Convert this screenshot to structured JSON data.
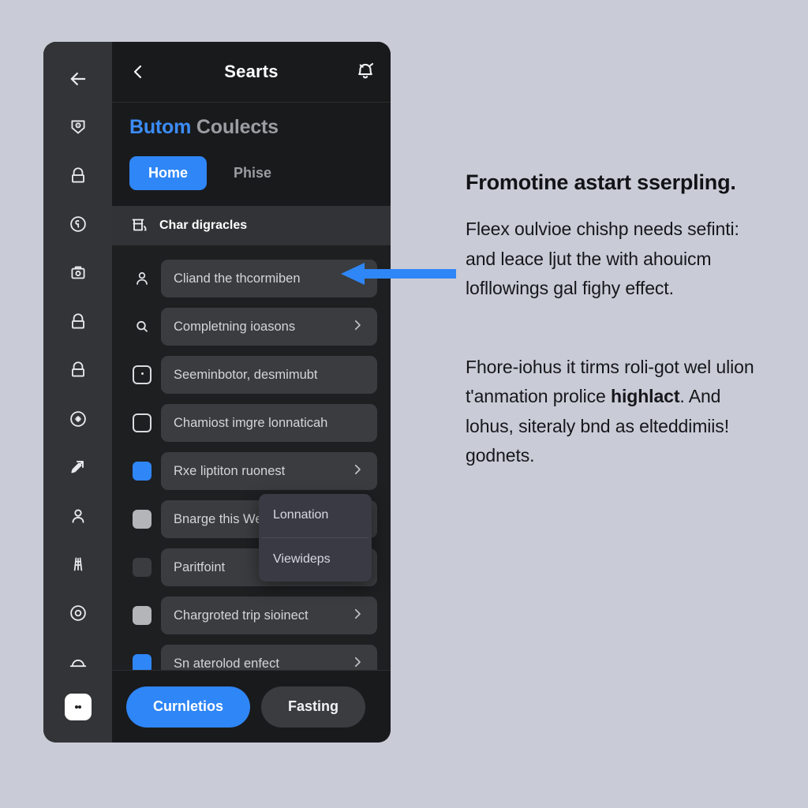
{
  "page": {
    "background_color": "#c9ccd6"
  },
  "panel": {
    "background_color": "#1d1f21",
    "accent_color": "#2f86f6"
  },
  "rail": {
    "items": [
      {
        "icon": "arrow-left-icon"
      },
      {
        "icon": "shield-camera-icon"
      },
      {
        "icon": "lock-icon"
      },
      {
        "icon": "clock-circle-icon"
      },
      {
        "icon": "camera-box-icon"
      },
      {
        "icon": "lock-icon"
      },
      {
        "icon": "lock-icon"
      },
      {
        "icon": "target-circle-icon"
      },
      {
        "icon": "pen-arrow-icon"
      },
      {
        "icon": "person-icon"
      },
      {
        "icon": "ladder-icon"
      },
      {
        "icon": "record-circle-icon"
      },
      {
        "icon": "arch-icon"
      }
    ],
    "more_icon": "more-vertical-icon"
  },
  "appbar": {
    "back_icon": "chevron-left-icon",
    "title": "Searts",
    "notification_icon": "bell-icon"
  },
  "titleblock": {
    "brand_accent": "Butom",
    "brand_muted": "Coulects",
    "tabs": [
      {
        "label": "Home",
        "active": true
      },
      {
        "label": "Phise",
        "active": false
      }
    ]
  },
  "section": {
    "icon": "table-chart-icon",
    "label": "Char digracles"
  },
  "list": {
    "rows": [
      {
        "lead_icon": "person-icon",
        "lead_type": "icon",
        "label": "Cliand the thcormiben",
        "chevron": false
      },
      {
        "lead_icon": "search-icon",
        "lead_type": "icon",
        "label": "Completning ioasons",
        "chevron": true
      },
      {
        "lead_icon": "checkbox-dotted-icon",
        "lead_type": "outline-dotted",
        "label": "Seeminbotor, desmimubt",
        "chevron": false
      },
      {
        "lead_icon": "checkbox-empty-icon",
        "lead_type": "outline",
        "label": "Chamiost imgre lonnaticah",
        "chevron": false
      },
      {
        "lead_icon": "swatch-blue-icon",
        "lead_type": "swatch",
        "swatch_color": "#2f86f6",
        "label": "Rxe liptiton ruonest",
        "chevron": true
      },
      {
        "lead_icon": "swatch-light-icon",
        "lead_type": "swatch",
        "swatch_color": "#b3b5b9",
        "label": "Bnarge this Weremont",
        "chevron": true
      },
      {
        "lead_icon": "swatch-dark-icon",
        "lead_type": "swatch",
        "swatch_color": "#3a3c3f",
        "label": "Paritfoint",
        "chevron": false
      },
      {
        "lead_icon": "swatch-light-icon",
        "lead_type": "swatch",
        "swatch_color": "#b3b5b9",
        "label": "Chargroted trip sioinect",
        "chevron": true
      },
      {
        "lead_icon": "swatch-blue-icon",
        "lead_type": "swatch",
        "swatch_color": "#2f86f6",
        "label": "Sn aterolod enfect",
        "chevron": true
      }
    ]
  },
  "popup": {
    "items": [
      {
        "label": "Lonnation"
      },
      {
        "label": "Viewideps"
      }
    ]
  },
  "actionbar": {
    "primary_label": "Curnletios",
    "secondary_label": "Fasting"
  },
  "annotation": {
    "arrow_color": "#2f86f6",
    "arrow_direction": "left",
    "heading": "Fromotine astart sserpling.",
    "paragraph_one": "Fleex oulvioe chishp needs sefinti: and leace ljut the with ahouicm lofllowings gal fighy effect.",
    "paragraph_two_before": "Fhore-iohus it tirms roli-got wel ulion t'anmation prolice ",
    "paragraph_two_bold": "highlact",
    "paragraph_two_after": ". And lohus, siteraly bnd as elteddimiis! godnets."
  }
}
